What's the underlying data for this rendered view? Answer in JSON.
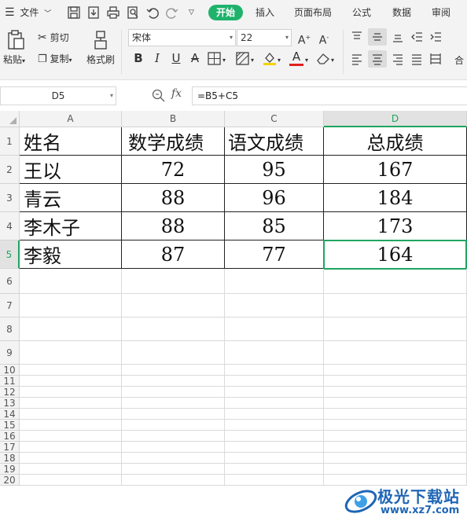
{
  "menubar": {
    "file_label": "文件",
    "tabs": [
      {
        "label": "开始",
        "active": true
      },
      {
        "label": "插入"
      },
      {
        "label": "页面布局"
      },
      {
        "label": "公式"
      },
      {
        "label": "数据"
      },
      {
        "label": "审阅"
      }
    ]
  },
  "ribbon": {
    "paste_label": "粘贴",
    "cut_label": "剪切",
    "copy_label": "复制",
    "format_painter_label": "格式刷",
    "font_name": "宋体",
    "font_size": "22",
    "merge_label": "合"
  },
  "formula_bar": {
    "name_box": "D5",
    "formula": "=B5+C5",
    "fx_label": "fx"
  },
  "sheet": {
    "col_headers": [
      "A",
      "B",
      "C",
      "D"
    ],
    "row_numbers": [
      "1",
      "2",
      "3",
      "4",
      "5",
      "6",
      "7",
      "8",
      "9",
      "10",
      "11",
      "12",
      "13",
      "14",
      "15",
      "16",
      "17",
      "18",
      "19",
      "20"
    ],
    "header_row": [
      "姓名",
      "数学成绩",
      "语文成绩",
      "总成绩"
    ],
    "rows": [
      [
        "王以",
        "72",
        "95",
        "167"
      ],
      [
        "青云",
        "88",
        "96",
        "184"
      ],
      [
        "李木子",
        "88",
        "85",
        "173"
      ],
      [
        "李毅",
        "87",
        "77",
        "164"
      ]
    ],
    "selected_cell": "D5"
  },
  "watermark": {
    "title": "极光下载站",
    "url": "www.xz7.com"
  },
  "colors": {
    "accent": "#1fb26b",
    "selection": "#1fa560",
    "font_color_red": "#e02020",
    "fill_yellow": "#f5d200"
  }
}
